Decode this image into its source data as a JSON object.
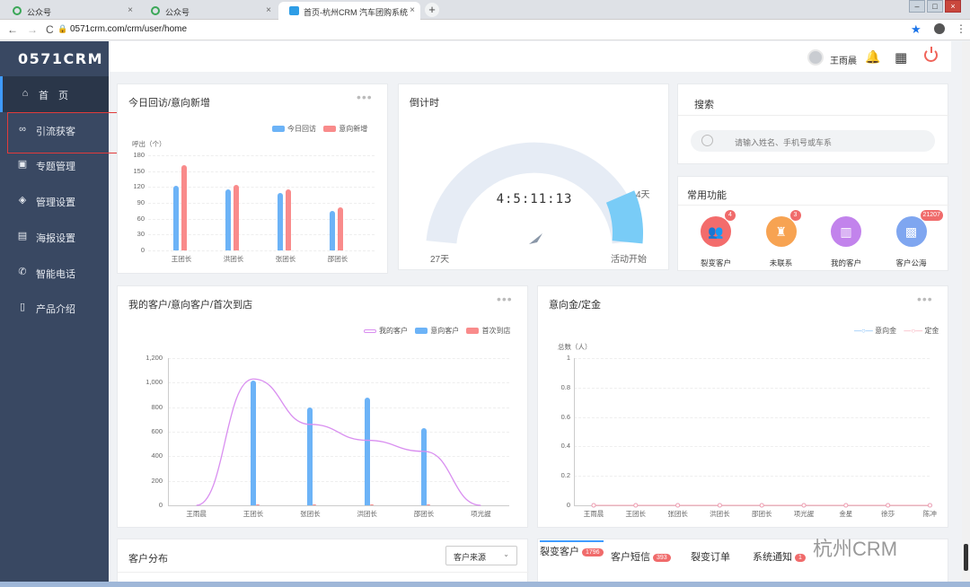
{
  "browser": {
    "tabs": [
      {
        "label": "公众号",
        "close": "×"
      },
      {
        "label": "公众号",
        "close": "×"
      },
      {
        "label": "首页-杭州CRM 汽车团购系统",
        "close": "×"
      }
    ],
    "new_tab": "+",
    "url": "0571crm.com/crm/user/home",
    "back": "←",
    "forward": "→",
    "reload": "C",
    "lock": "🔒",
    "star": "★",
    "menu": "⋮",
    "win_min": "–",
    "win_max": "□",
    "win_close": "×"
  },
  "sidebar": {
    "logo": "0571CRM",
    "items": [
      {
        "label": "首　页",
        "icon": "home-icon",
        "glyph": "⌂"
      },
      {
        "label": "引流获客",
        "icon": "traffic-icon",
        "glyph": "∞"
      },
      {
        "label": "专题管理",
        "icon": "topic-icon",
        "glyph": "▣"
      },
      {
        "label": "管理设置",
        "icon": "layers-icon",
        "glyph": "◈"
      },
      {
        "label": "海报设置",
        "icon": "image-icon",
        "glyph": "▤"
      },
      {
        "label": "智能电话",
        "icon": "phone-icon",
        "glyph": "✆"
      },
      {
        "label": "产品介绍",
        "icon": "book-icon",
        "glyph": "▯"
      }
    ]
  },
  "header": {
    "username": "王雨晨",
    "bell": "🔔",
    "grid": "▦"
  },
  "today_card": {
    "title": "今日回访/意向新增",
    "more": "•••",
    "legend": [
      "今日回访",
      "意向新增"
    ],
    "colors": [
      "#6cb3f7",
      "#f98b8b"
    ],
    "y_unit": "呼出（个）",
    "y_ticks": [
      "180",
      "150",
      "120",
      "90",
      "60",
      "30",
      "0"
    ]
  },
  "countdown": {
    "title": "倒计时",
    "time": "4:5:11:13",
    "left_label": "27天",
    "right_label": "4天",
    "bottom_label": "活动开始",
    "progress": 0.15
  },
  "search": {
    "title": "搜索",
    "placeholder": "请输入姓名、手机号或车系"
  },
  "functions": {
    "title": "常用功能",
    "items": [
      {
        "label": "裂变客户",
        "badge": "4",
        "color": "#f36c6c",
        "glyph": "👥",
        "icon": "fission-customer-icon"
      },
      {
        "label": "未联系",
        "badge": "3",
        "color": "#f7a352",
        "glyph": "♜",
        "icon": "uncontacted-icon"
      },
      {
        "label": "我的客户",
        "badge": "",
        "color": "#c283ec",
        "glyph": "▥",
        "icon": "my-customer-icon"
      },
      {
        "label": "客户公海",
        "badge": "21207",
        "color": "#7fa6f0",
        "glyph": "▩",
        "icon": "customer-pool-icon"
      }
    ]
  },
  "customer_card": {
    "title": "我的客户/意向客户/首次到店",
    "more": "•••",
    "legend": [
      "我的客户",
      "意向客户",
      "首次到店"
    ],
    "y_ticks": [
      "1,200",
      "1,000",
      "800",
      "600",
      "400",
      "200",
      "0"
    ]
  },
  "deposit_card": {
    "title": "意向金/定金",
    "more": "•••",
    "legend": [
      "意向金",
      "定金"
    ],
    "y_unit": "总数（人）",
    "y_ticks": [
      "1",
      "0.8",
      "0.6",
      "0.4",
      "0.2",
      "0"
    ]
  },
  "distribution": {
    "title": "客户分布",
    "select": "客户来源"
  },
  "bottom_tabs": [
    {
      "label": "裂变客户",
      "badge": "1796"
    },
    {
      "label": "客户短信",
      "badge": "393"
    },
    {
      "label": "裂变订单",
      "badge": ""
    },
    {
      "label": "系统通知",
      "badge": "1"
    }
  ],
  "watermark": "杭州CRM",
  "chart_data": [
    {
      "type": "bar",
      "title": "今日回访/意向新增",
      "ylabel": "呼出（个）",
      "categories": [
        "王团长",
        "洪团长",
        "张团长",
        "邵团长"
      ],
      "series": [
        {
          "name": "今日回访",
          "values": [
            122,
            116,
            108,
            74
          ]
        },
        {
          "name": "意向新增",
          "values": [
            162,
            124,
            116,
            82
          ]
        }
      ],
      "ylim": [
        0,
        180
      ],
      "legend": "top-right"
    },
    {
      "type": "bar",
      "title": "我的客户/意向客户/首次到店",
      "categories": [
        "王雨晨",
        "王团长",
        "张团长",
        "洪团长",
        "邵团长",
        "项光謃"
      ],
      "series": [
        {
          "name": "我的客户",
          "type": "line",
          "values": [
            0,
            1030,
            660,
            530,
            440,
            0
          ]
        },
        {
          "name": "意向客户",
          "values": [
            0,
            1020,
            800,
            880,
            630,
            0
          ]
        },
        {
          "name": "首次到店",
          "values": [
            0,
            5,
            5,
            5,
            5,
            0
          ]
        }
      ],
      "ylim": [
        0,
        1200
      ],
      "legend": "top-right"
    },
    {
      "type": "line",
      "title": "意向金/定金",
      "ylabel": "总数（人）",
      "categories": [
        "王雨晨",
        "王团长",
        "张团长",
        "洪团长",
        "邵团长",
        "项光謃",
        "金星",
        "徐莎",
        "陈冲"
      ],
      "series": [
        {
          "name": "意向金",
          "values": [
            0,
            0,
            0,
            0,
            0,
            0,
            0,
            0,
            0
          ]
        },
        {
          "name": "定金",
          "values": [
            0,
            0,
            0,
            0,
            0,
            0,
            0,
            0,
            0
          ]
        }
      ],
      "ylim": [
        0,
        1
      ],
      "legend": "top-right"
    }
  ]
}
